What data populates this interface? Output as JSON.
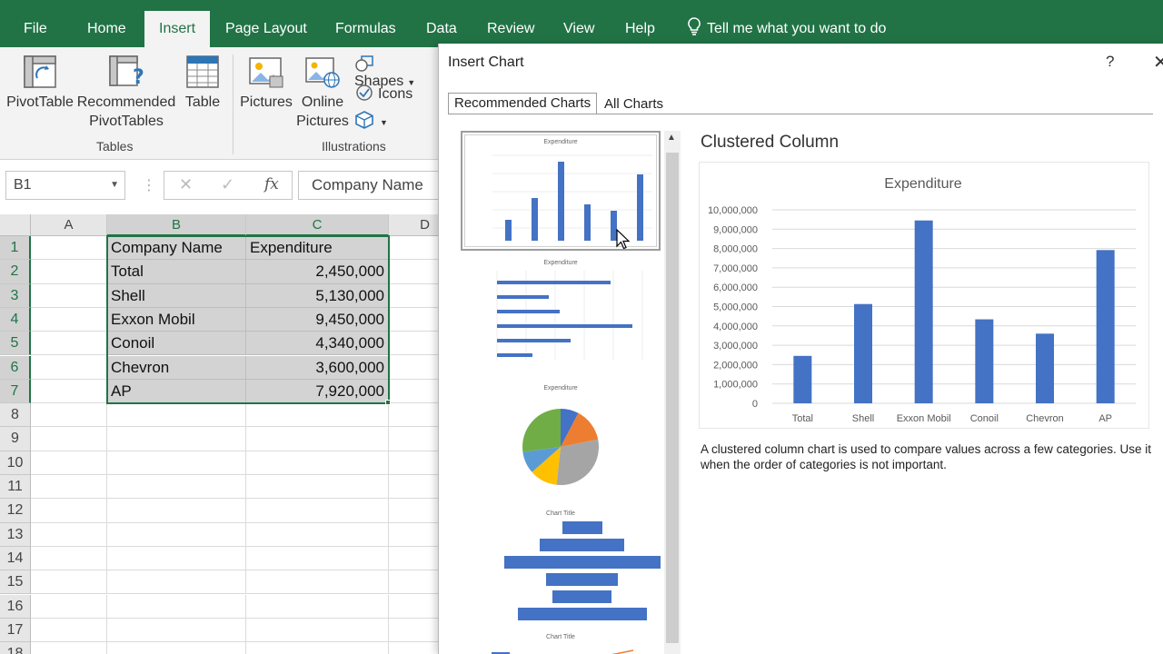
{
  "ribbon": {
    "tabs": [
      "File",
      "Home",
      "Insert",
      "Page Layout",
      "Formulas",
      "Data",
      "Review",
      "View",
      "Help"
    ],
    "active_tab": "Insert",
    "tell_me": "Tell me what you want to do",
    "buttons": {
      "pivottable": "PivotTable",
      "recommended_line1": "Recommended",
      "recommended_line2": "PivotTables",
      "table": "Table",
      "pictures": "Pictures",
      "online_line1": "Online",
      "online_line2": "Pictures",
      "shapes": "Shapes",
      "icons": "Icons"
    },
    "groups": {
      "tables": "Tables",
      "illustrations": "Illustrations"
    },
    "colors": {
      "accent": "#217346"
    }
  },
  "formula_bar": {
    "name_box": "B1",
    "content": "Company Name"
  },
  "sheet": {
    "columns": [
      "A",
      "B",
      "C",
      "D"
    ],
    "rows": [
      "1",
      "2",
      "3",
      "4",
      "5",
      "6",
      "7",
      "8",
      "9",
      "10",
      "11",
      "12",
      "13",
      "14",
      "15",
      "16",
      "17",
      "18"
    ],
    "data": [
      [
        "Company Name",
        "Expenditure"
      ],
      [
        "Total",
        "2,450,000"
      ],
      [
        "Shell",
        "5,130,000"
      ],
      [
        "Exxon Mobil",
        "9,450,000"
      ],
      [
        "Conoil",
        "4,340,000"
      ],
      [
        "Chevron",
        "3,600,000"
      ],
      [
        "AP",
        "7,920,000"
      ]
    ]
  },
  "dialog": {
    "title": "Insert Chart",
    "help": "?",
    "close": "✕",
    "tabs": [
      "Recommended Charts",
      "All Charts"
    ],
    "preview_title": "Clustered Column",
    "description": "A clustered column chart is used to compare values across a few categories. Use it when the order of categories is not important.",
    "thumb_titles": [
      "Expenditure",
      "Expenditure",
      "Expenditure",
      "Chart Title",
      "Chart Title"
    ]
  },
  "chart_data": {
    "type": "bar",
    "title": "Expenditure",
    "categories": [
      "Total",
      "Shell",
      "Exxon Mobil",
      "Conoil",
      "Chevron",
      "AP"
    ],
    "values": [
      2450000,
      5130000,
      9450000,
      4340000,
      3600000,
      7920000
    ],
    "ylim": [
      0,
      10000000
    ],
    "yticks": [
      "0",
      "1,000,000",
      "2,000,000",
      "3,000,000",
      "4,000,000",
      "5,000,000",
      "6,000,000",
      "7,000,000",
      "8,000,000",
      "9,000,000",
      "10,000,000"
    ],
    "xlabel": "",
    "ylabel": "",
    "grid": true,
    "color": "#4472c4"
  }
}
